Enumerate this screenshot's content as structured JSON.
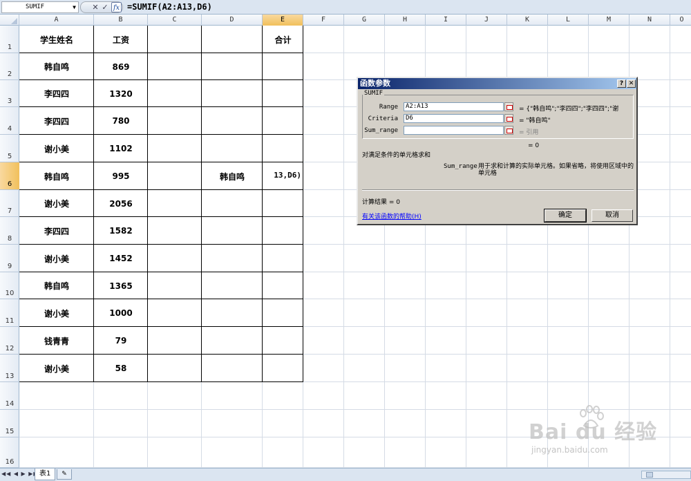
{
  "formula_bar": {
    "name_box": "SUMIF",
    "cancel_icon": "✕",
    "enter_icon": "✓",
    "fx_label": "fx",
    "formula": "=SUMIF(A2:A13,D6)"
  },
  "columns": [
    "A",
    "B",
    "C",
    "D",
    "E",
    "F",
    "G",
    "H",
    "I",
    "J",
    "K",
    "L",
    "M",
    "N",
    "O"
  ],
  "rows": [
    "1",
    "2",
    "3",
    "4",
    "5",
    "6",
    "7",
    "8",
    "9",
    "10",
    "11",
    "12",
    "13",
    "14",
    "15",
    "16"
  ],
  "selected_column": "E",
  "selected_row": "6",
  "table": {
    "header_name": "学生姓名",
    "header_salary": "工资",
    "header_total": "合计",
    "rows": [
      {
        "name": "韩自鸣",
        "salary": "869"
      },
      {
        "name": "李四四",
        "salary": "1320"
      },
      {
        "name": "李四四",
        "salary": "780"
      },
      {
        "name": "谢小美",
        "salary": "1102"
      },
      {
        "name": "韩自鸣",
        "salary": "995"
      },
      {
        "name": "谢小美",
        "salary": "2056"
      },
      {
        "name": "李四四",
        "salary": "1582"
      },
      {
        "name": "谢小美",
        "salary": "1452"
      },
      {
        "name": "韩自鸣",
        "salary": "1365"
      },
      {
        "name": "谢小美",
        "salary": "1000"
      },
      {
        "name": "钱青青",
        "salary": "79"
      },
      {
        "name": "谢小美",
        "salary": "58"
      }
    ],
    "criteria_cell": "韩自鸣",
    "editing_cell_text": "13,D6)"
  },
  "dialog": {
    "title": "函数参数",
    "help_btn": "?",
    "close_btn": "✕",
    "group_label": "SUMIF",
    "args": [
      {
        "label": "Range",
        "value": "A2:A13",
        "result": "= {\"韩自鸣\";\"李四四\";\"李四四\";\"谢",
        "grey": false
      },
      {
        "label": "Criteria",
        "value": "D6",
        "result": "= \"韩自鸣\"",
        "grey": false
      },
      {
        "label": "Sum_range",
        "value": "",
        "result": "= 引用",
        "grey": true
      }
    ],
    "total_result": "= 0",
    "description": "对满足条件的单元格求和",
    "arg_name": "Sum_range",
    "arg_description": "用于求和计算的实际单元格。如果省略，将使用区域中的单元格",
    "calc_result": "计算结果 = 0",
    "help_link": "有关该函数的帮助(H)",
    "ok_label": "确定",
    "cancel_label": "取消"
  },
  "sheet_tabs": {
    "nav": "◀◀ ◀ ▶ ▶▶",
    "active_tab": "表1",
    "new_tab_icon": "✎"
  },
  "watermark": {
    "logo": "Bai du 经验",
    "url": "jingyan.baidu.com"
  }
}
